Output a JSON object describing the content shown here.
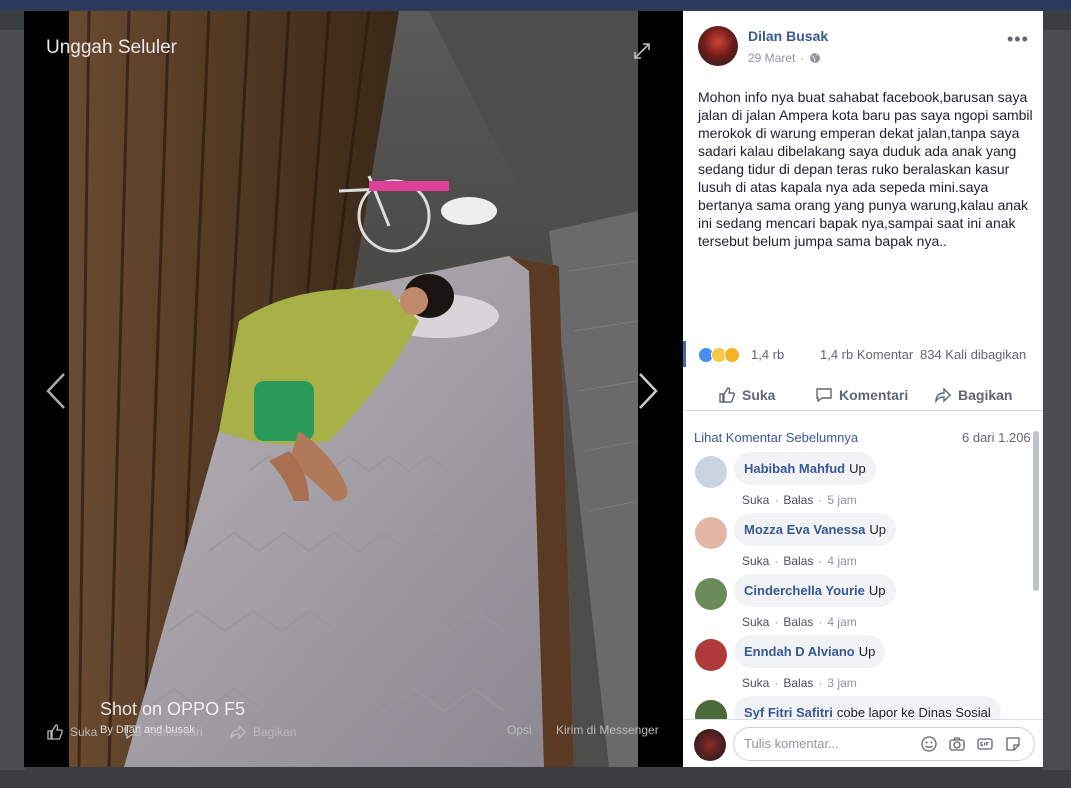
{
  "viewer": {
    "title": "Unggah Seluler",
    "watermark": "Shot on OPPO F5",
    "watermark_sub": "By Dilan and busak",
    "actions": {
      "like": "Suka",
      "comment": "Komentari",
      "share": "Bagikan",
      "options": "Opsi",
      "messenger": "Kirim di Messenger"
    }
  },
  "post": {
    "author": "Dilan Busak",
    "date": "29 Maret",
    "text": "Mohon info nya buat sahabat facebook,barusan saya jalan di jalan Ampera kota baru pas saya ngopi sambil merokok di warung emperan dekat jalan,tanpa saya sadari kalau dibelakang saya duduk ada anak yang sedang tidur di depan teras ruko beralaskan kasur lusuh di atas kapala nya ada sepeda mini.saya bertanya sama orang yang punya warung,kalau anak ini sedang mencari bapak nya,sampai saat ini anak tersebut belum jumpa sama bapak nya..",
    "reactions": "1,4 rb",
    "comment_count": "1,4 rb Komentar",
    "share_count": "834 Kali dibagikan",
    "actions": {
      "like": "Suka",
      "comment": "Komentari",
      "share": "Bagikan"
    }
  },
  "comments": {
    "prev_link": "Lihat Komentar Sebelumnya",
    "count": "6 dari 1.206",
    "items": [
      {
        "name": "Habibah Mahfud",
        "text": "Up",
        "like": "Suka",
        "reply": "Balas",
        "time": "5 jam",
        "avatar_color": "#c9d4e0"
      },
      {
        "name": "Mozza Eva Vanessa",
        "text": "Up",
        "like": "Suka",
        "reply": "Balas",
        "time": "4 jam",
        "avatar_color": "#e3b7a5"
      },
      {
        "name": "Cinderchella Yourie",
        "text": "Up",
        "like": "Suka",
        "reply": "Balas",
        "time": "4 jam",
        "avatar_color": "#6b8b5a"
      },
      {
        "name": "Enndah D Alviano",
        "text": "Up",
        "like": "Suka",
        "reply": "Balas",
        "time": "3 jam",
        "avatar_color": "#b03a3a"
      },
      {
        "name": "Syf Fitri Safitri",
        "text": "cobe lapor ke Dinas Sosial",
        "like": "",
        "reply": "",
        "time": "",
        "avatar_color": "#4a6a3a"
      }
    ],
    "input_placeholder": "Tulis komentar..."
  },
  "colors": {
    "link": "#385898",
    "viewer_bg": "#000000",
    "panel_bg": "#ffffff"
  }
}
